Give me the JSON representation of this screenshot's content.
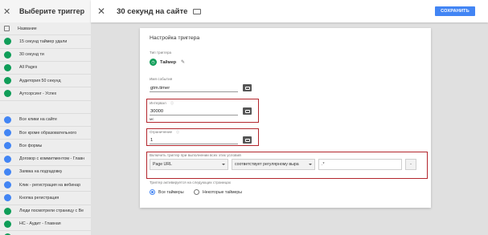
{
  "left_panel": {
    "title": "Выберите триггер",
    "items": [
      {
        "label": "Название",
        "color": "header",
        "icon": "checkbox-icon"
      },
      {
        "label": "15 секунд таймер удали",
        "color": "#0f9d58",
        "icon": "timer-icon"
      },
      {
        "label": "30 секунд ти",
        "color": "#0f9d58",
        "icon": "timer-icon"
      },
      {
        "label": "All Pages",
        "color": "#0f9d58",
        "icon": "eye-icon"
      },
      {
        "label": "Аудитория 50 секунд",
        "color": "#0f9d58",
        "icon": "timer-icon"
      },
      {
        "label": "Аутсорсинг - Успех",
        "color": "#0f9d58",
        "icon": "timer-icon"
      },
      {
        "label": "",
        "color": "blank",
        "icon": ""
      },
      {
        "label": "Все клики на сайте",
        "color": "#4285f4",
        "icon": "click-icon"
      },
      {
        "label": "Все кроме образовательного",
        "color": "#4285f4",
        "icon": "click-icon"
      },
      {
        "label": "Все формы",
        "color": "#4285f4",
        "icon": "form-icon"
      },
      {
        "label": "Договор с коммитментом - Главн",
        "color": "#4285f4",
        "icon": "click-icon"
      },
      {
        "label": "Заявка на подгадовку",
        "color": "#4285f4",
        "icon": "click-icon"
      },
      {
        "label": "Клик - регистрация на вебинар",
        "color": "#4285f4",
        "icon": "click-icon"
      },
      {
        "label": "Кнопка регистрация",
        "color": "#4285f4",
        "icon": "click-icon"
      },
      {
        "label": "Люди посмотрели страницу с Ве",
        "color": "#0f9d58",
        "icon": "eye-icon"
      },
      {
        "label": "НС - Аудит - Главная",
        "color": "#0f9d58",
        "icon": "eye-icon"
      },
      {
        "label": "НС - Аудит - Страница - Успех",
        "color": "#0f9d58",
        "icon": "eye-icon"
      }
    ]
  },
  "topbar": {
    "trigger_name": "30 секунд на сайте",
    "save_label": "СОХРАНИТЬ"
  },
  "card": {
    "title": "Настройка триггера",
    "type_label": "Тип триггера",
    "type_name": "Таймер",
    "event_label": "Имя события",
    "event_value": "gtm.timer",
    "interval_label": "Интервал",
    "interval_value": "30000",
    "interval_units": "мс",
    "limit_label": "Ограничение",
    "limit_value": "1",
    "condition_label": "Включить триггер при выполнении всех этих условий",
    "condition_variable": "Page URL",
    "condition_operator": "соответствует регулярному выра",
    "condition_value": ".*",
    "condition_remove": "-",
    "fire_on_label": "Триггер активируется на следующих страницах",
    "radio_all": "Все таймеры",
    "radio_some": "Некоторые таймеры"
  },
  "colors": {
    "accent": "#4285f4",
    "highlight": "#b3262d",
    "timer_green": "#0f9d58"
  }
}
